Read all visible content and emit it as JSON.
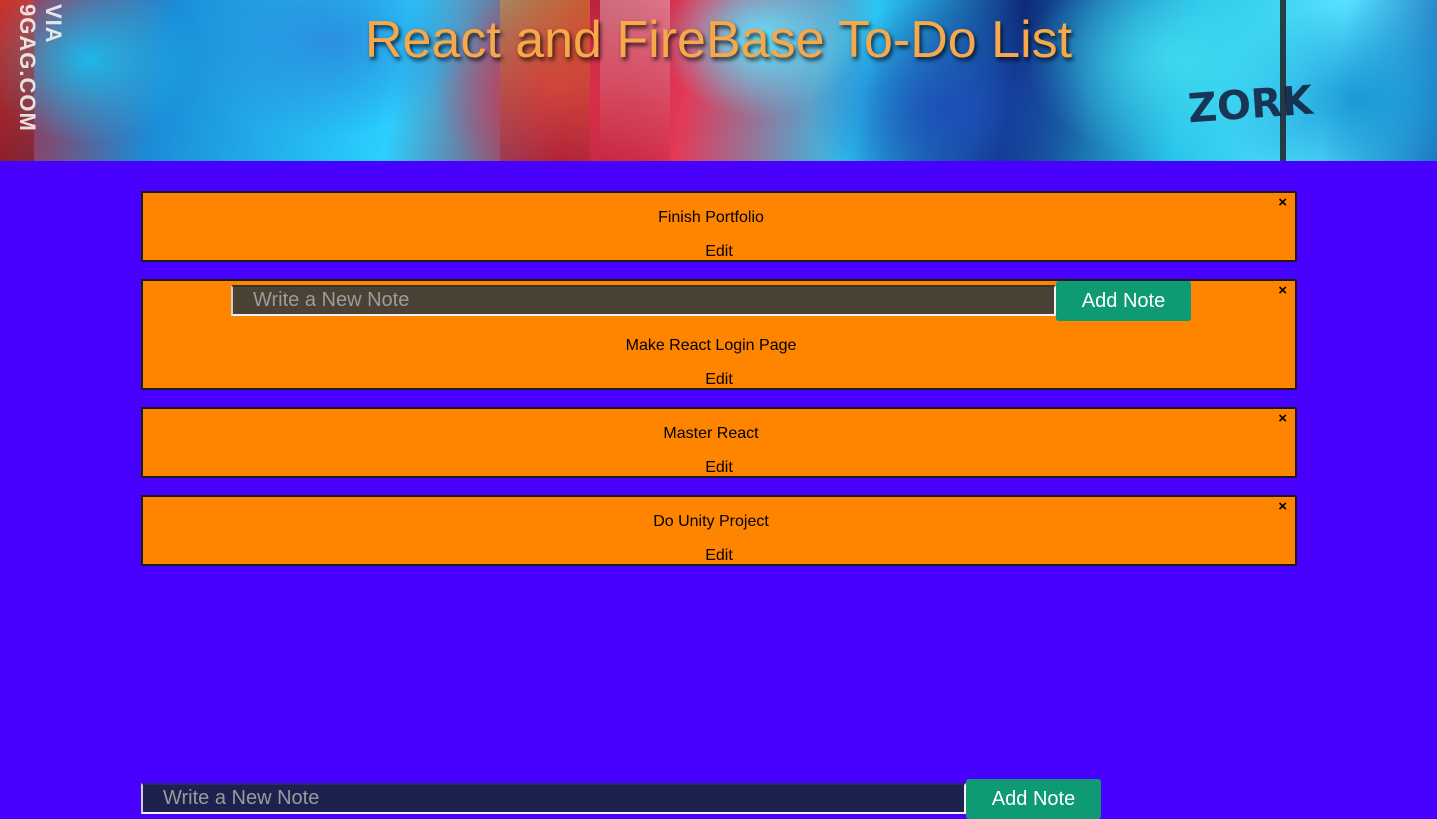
{
  "header": {
    "title": "React and FireBase To-Do List",
    "wall_tag": "VIA 9GAG.COM",
    "wall_word": "ZORK"
  },
  "colors": {
    "page_background": "#4800ff",
    "note_background": "#ff8400",
    "title_color": "#f7a84a",
    "button_background": "#0e9a72"
  },
  "notes": [
    {
      "text": "Finish Portfolio",
      "edit_label": "Edit",
      "close_icon": "×",
      "editing": false
    },
    {
      "text": "Make React Login Page",
      "edit_label": "Edit",
      "close_icon": "×",
      "editing": true,
      "form": {
        "placeholder": "Write a New Note",
        "button_label": "Add Note"
      }
    },
    {
      "text": "Master React",
      "edit_label": "Edit",
      "close_icon": "×",
      "editing": false
    },
    {
      "text": "Do Unity Project",
      "edit_label": "Edit",
      "close_icon": "×",
      "editing": false
    }
  ],
  "new_note_form": {
    "placeholder": "Write a New Note",
    "button_label": "Add Note"
  }
}
